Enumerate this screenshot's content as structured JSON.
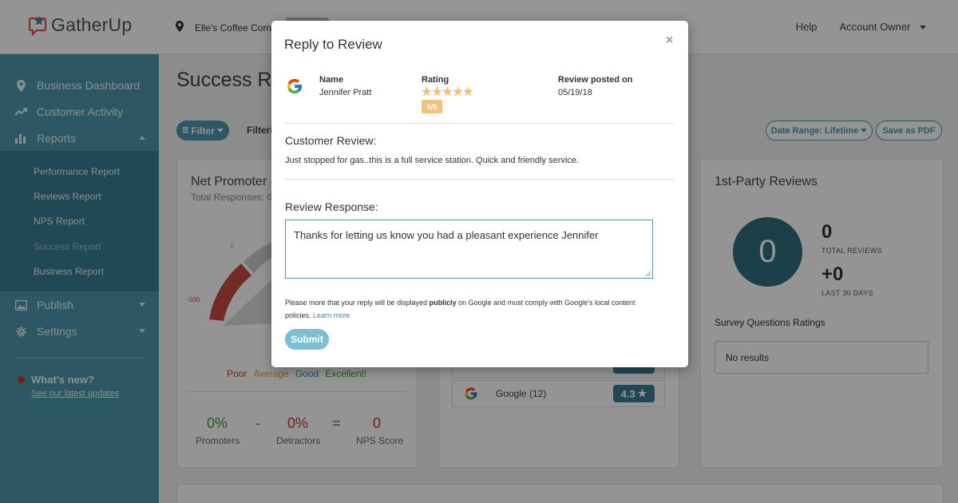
{
  "app": {
    "brand": "GatherUp"
  },
  "header": {
    "location": "Elle's Coffee Corne",
    "help": "Help",
    "account": "Account Owner"
  },
  "sidebar": {
    "items": [
      {
        "label": "Business Dashboard",
        "icon": "pin-icon"
      },
      {
        "label": "Customer Activity",
        "icon": "trend-icon"
      },
      {
        "label": "Reports",
        "icon": "bar-chart-icon"
      },
      {
        "label": "Publish",
        "icon": "image-icon"
      },
      {
        "label": "Settings",
        "icon": "gear-icon"
      }
    ],
    "reports_sub": [
      {
        "label": "Performance Report"
      },
      {
        "label": "Reviews Report"
      },
      {
        "label": "NPS Report"
      },
      {
        "label": "Success Report"
      },
      {
        "label": "Business Report"
      }
    ],
    "whats_new": "What's new?",
    "latest_updates": "See our latest updates"
  },
  "main": {
    "title": "Success Rep",
    "filter_button": "Filter",
    "filter_label": "Filteri",
    "date_range": "Date Range: Lifetime",
    "save_pdf": "Save as PDF",
    "nps_card": {
      "title": "Net Promoter S",
      "total": "Total Responses: 0",
      "gauge_labels": {
        "zero": "0",
        "minus100": "-100"
      },
      "legend": [
        "Poor",
        "Average",
        "Good",
        "Excellent!"
      ],
      "promoters_value": "0%",
      "promoters_label": "Promoters",
      "minus": "-",
      "detractors_value": "0%",
      "detractors_label": "Detractors",
      "equals": "=",
      "score_value": "0",
      "score_label": "NPS Score"
    },
    "sources": {
      "google_label": "Google (12)",
      "google_rating": "4.3"
    },
    "first_party": {
      "title": "1st-Party Reviews",
      "circle_value": "0",
      "total_reviews_value": "0",
      "total_reviews_label": "TOTAL REVIEWS",
      "last30_value": "+0",
      "last30_label": "LAST 30 DAYS",
      "survey_title": "Survey Questions Ratings",
      "no_results": "No results"
    }
  },
  "modal": {
    "title": "Reply to Review",
    "close": "×",
    "name_label": "Name",
    "name_value": "Jennifer Pratt",
    "rating_label": "Rating",
    "rating_stars": 5,
    "rating_badge": "5/5",
    "posted_label": "Review posted on",
    "posted_value": "05/19/18",
    "customer_review_heading": "Customer Review:",
    "customer_review_text": "Just stopped for gas..this is a full service station. Quick and friendly service.",
    "response_heading": "Review Response:",
    "response_value": "Thanks for letting us know you had a pleasant experience Jennifer",
    "notice_part1": "Please more that your reply will be displayed ",
    "notice_bold": "publicly",
    "notice_part2": " on Google and must comply with Google's local content policies. ",
    "learn_more": "Learn more",
    "submit": "Submit"
  },
  "colors": {
    "teal": "#4d98ad",
    "teal_dark": "#3a7e93",
    "star_gold": "#f0c27a"
  }
}
